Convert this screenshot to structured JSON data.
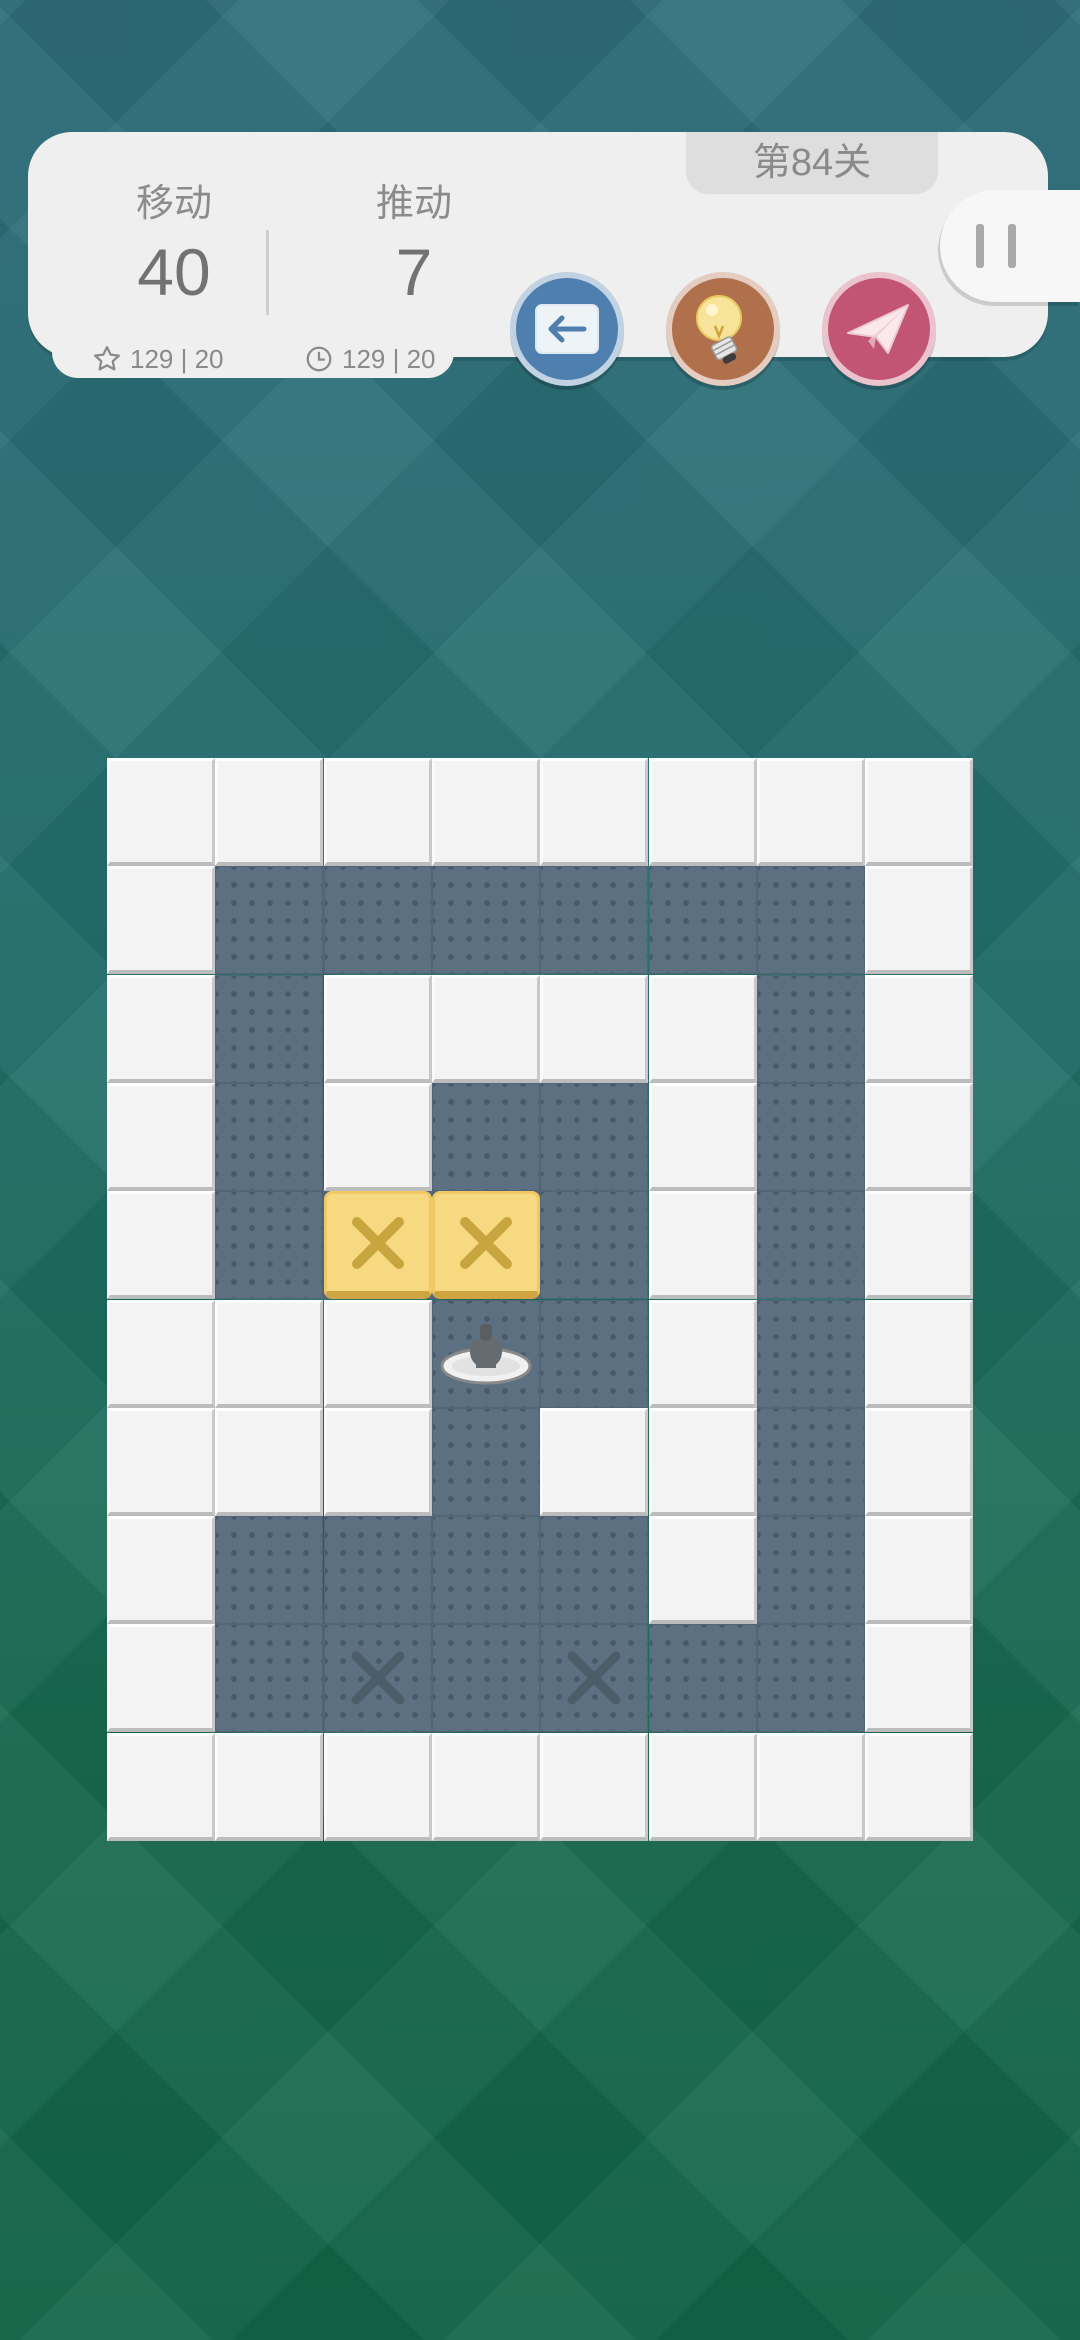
{
  "hud": {
    "moves_label": "移动",
    "moves_value": "40",
    "pushes_label": "推动",
    "pushes_value": "7",
    "best_moves": "129 | 20",
    "best_time": "129 | 20",
    "level_label": "第84关"
  },
  "buttons": {
    "undo": "undo-icon",
    "hint": "lightbulb-icon",
    "share": "paper-plane-icon",
    "pause": "pause-icon"
  },
  "colors": {
    "undo": "#4f7fae",
    "hint": "#b1704c",
    "share": "#c25574",
    "floor": "#5c7081",
    "wall": "#f3f3f3",
    "crate": "#f7d982"
  },
  "board": {
    "cols": 8,
    "rows": 10,
    "map": [
      "########",
      "#______#",
      "#_####_#",
      "#_#__#_#",
      "#_BB_#_#",
      "###P_#_#",
      "###_##_#",
      "#____#_#",
      "#_T_T__#",
      "########"
    ],
    "crates": [
      [
        4,
        2
      ],
      [
        4,
        3
      ]
    ],
    "targets": [
      [
        8,
        2
      ],
      [
        8,
        4
      ]
    ],
    "player": [
      5,
      3
    ]
  }
}
